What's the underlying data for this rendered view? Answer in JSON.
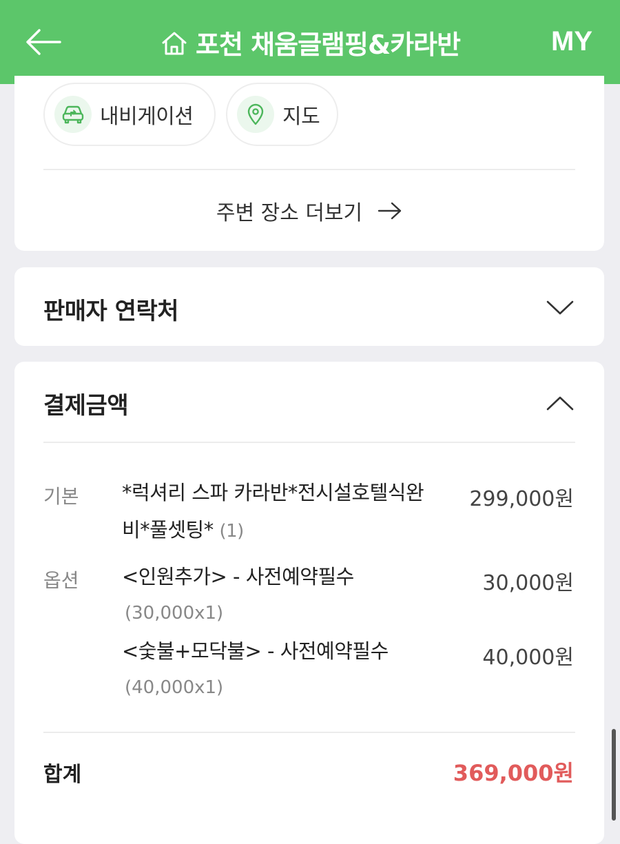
{
  "header": {
    "title": "포천 채움글램핑&카라반",
    "my_label": "MY",
    "color": "#5cc66a"
  },
  "location": {
    "navigation_label": "내비게이션",
    "map_label": "지도",
    "more_label": "주변 장소 더보기",
    "nav_icon": "car-route-icon",
    "map_icon": "map-pin-icon"
  },
  "seller": {
    "title": "판매자 연락처",
    "expanded": false
  },
  "payment": {
    "title": "결제금액",
    "expanded": true,
    "base": {
      "label": "기본",
      "name_line1": "*럭셔리 스파 카라반*전시설호텔식완",
      "name_line2": "비*풀셋팅*",
      "qty": "(1)",
      "price": "299,000원"
    },
    "options_label": "옵션",
    "options": [
      {
        "name": "<인원추가> - 사전예약필수",
        "detail": "(30,000x1)",
        "price": "30,000원"
      },
      {
        "name": "<숯불+모닥불> - 사전예약필수",
        "detail": "(40,000x1)",
        "price": "40,000원"
      }
    ],
    "total_label": "합계",
    "total_price": "369,000원",
    "total_color": "#e15b5b"
  }
}
